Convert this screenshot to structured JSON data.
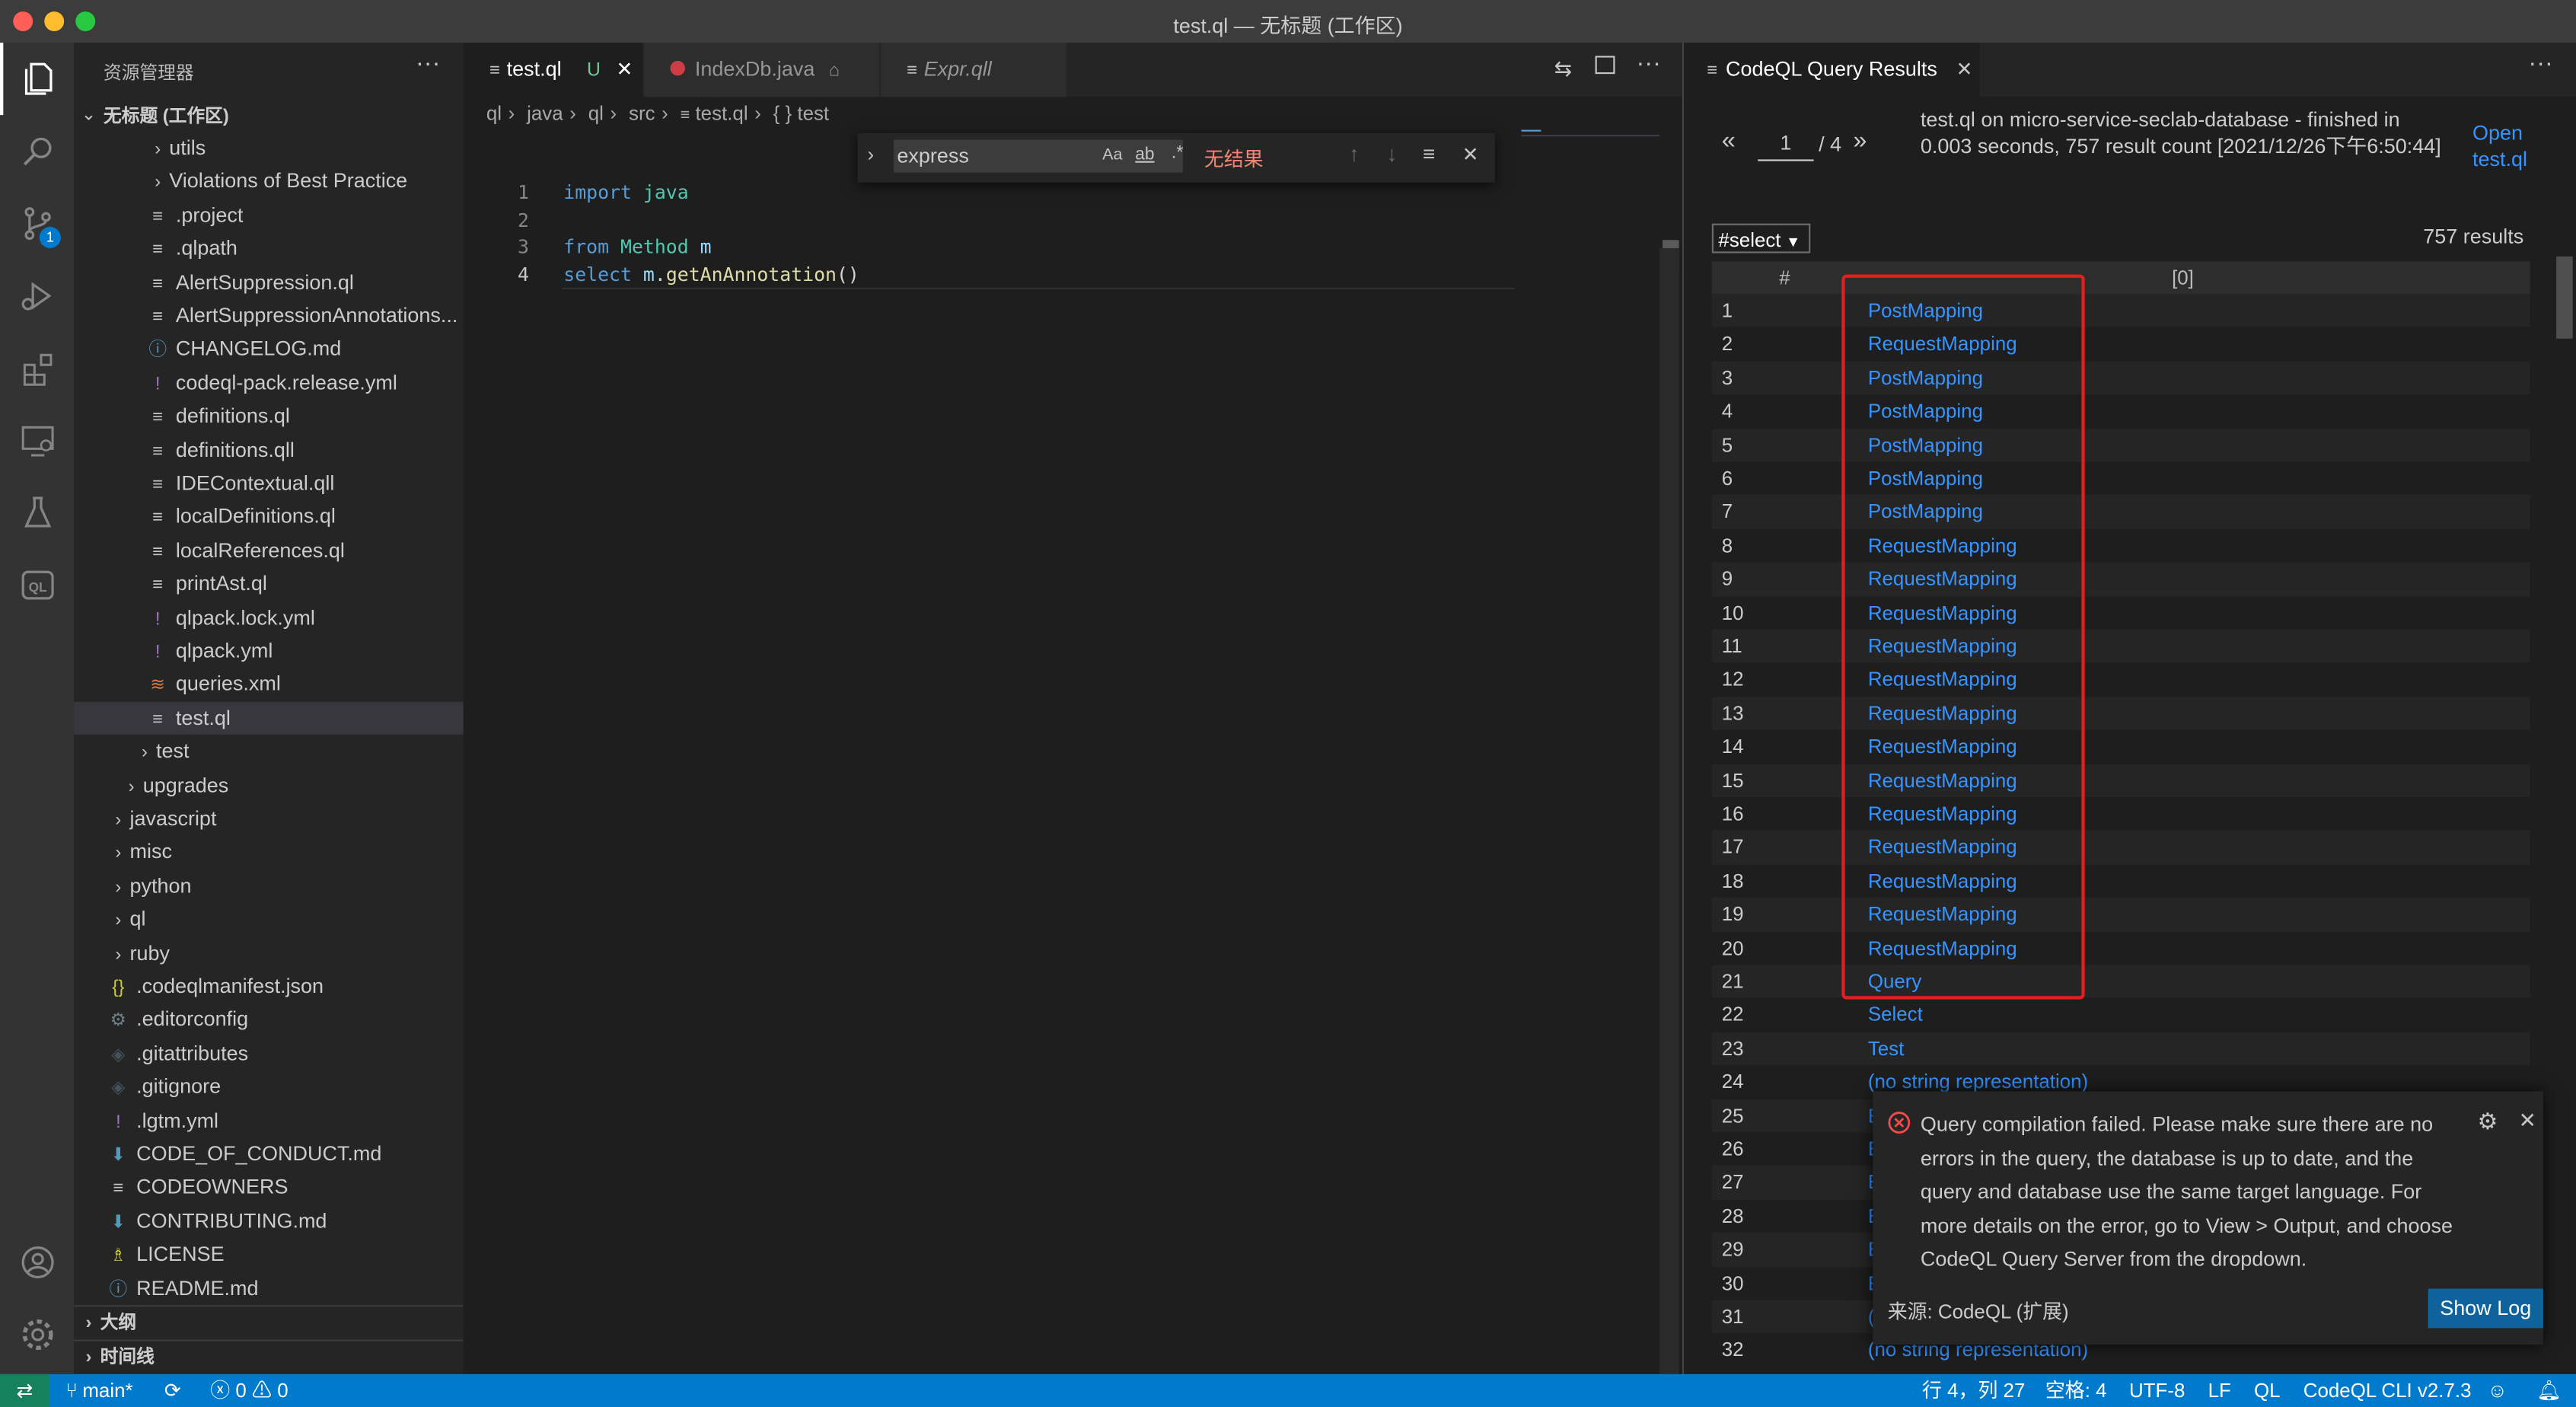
{
  "window": {
    "title": "test.ql — 无标题 (工作区)"
  },
  "activity_bar": {
    "source_control_badge": "1"
  },
  "explorer": {
    "header": "资源管理器",
    "workspace": "无标题 (工作区)",
    "items": [
      {
        "label": "utils",
        "kind": "folder",
        "status": ""
      },
      {
        "label": "Violations of Best Practice",
        "kind": "folder",
        "status": ""
      },
      {
        "label": ".project",
        "kind": "file",
        "status": ""
      },
      {
        "label": ".qlpath",
        "kind": "file",
        "status": ""
      },
      {
        "label": "AlertSuppression.ql",
        "kind": "file",
        "status": ""
      },
      {
        "label": "AlertSuppressionAnnotations...",
        "kind": "file",
        "status": ""
      },
      {
        "label": "CHANGELOG.md",
        "kind": "md",
        "status": ""
      },
      {
        "label": "codeql-pack.release.yml",
        "kind": "yml",
        "status": ""
      },
      {
        "label": "definitions.ql",
        "kind": "file",
        "status": ""
      },
      {
        "label": "definitions.qll",
        "kind": "file",
        "status": ""
      },
      {
        "label": "IDEContextual.qll",
        "kind": "file",
        "status": ""
      },
      {
        "label": "localDefinitions.ql",
        "kind": "file",
        "status": ""
      },
      {
        "label": "localReferences.ql",
        "kind": "file",
        "status": ""
      },
      {
        "label": "printAst.ql",
        "kind": "file",
        "status": ""
      },
      {
        "label": "qlpack.lock.yml",
        "kind": "yml",
        "status": ""
      },
      {
        "label": "qlpack.yml",
        "kind": "yml",
        "status": ""
      },
      {
        "label": "queries.xml",
        "kind": "xml",
        "status": ""
      },
      {
        "label": "test.ql",
        "kind": "file",
        "status": "U"
      },
      {
        "label": "test",
        "kind": "folder",
        "status": ""
      },
      {
        "label": "upgrades",
        "kind": "folder",
        "status": ""
      },
      {
        "label": "javascript",
        "kind": "folder",
        "status": ""
      },
      {
        "label": "misc",
        "kind": "folder",
        "status": ""
      },
      {
        "label": "python",
        "kind": "folder",
        "status": ""
      },
      {
        "label": "ql",
        "kind": "folder",
        "status": ""
      },
      {
        "label": "ruby",
        "kind": "folder",
        "status": ""
      },
      {
        "label": ".codeqlmanifest.json",
        "kind": "json",
        "status": ""
      },
      {
        "label": ".editorconfig",
        "kind": "gear",
        "status": ""
      },
      {
        "label": ".gitattributes",
        "kind": "git",
        "status": ""
      },
      {
        "label": ".gitignore",
        "kind": "git",
        "status": ""
      },
      {
        "label": ".lgtm.yml",
        "kind": "yml",
        "status": ""
      },
      {
        "label": "CODE_OF_CONDUCT.md",
        "kind": "dl",
        "status": ""
      },
      {
        "label": "CODEOWNERS",
        "kind": "file",
        "status": ""
      },
      {
        "label": "CONTRIBUTING.md",
        "kind": "dl",
        "status": ""
      },
      {
        "label": "LICENSE",
        "kind": "license",
        "status": ""
      },
      {
        "label": "README.md",
        "kind": "info",
        "status": ""
      }
    ],
    "outline": "大纲",
    "timeline": "时间线"
  },
  "editor": {
    "tabs": [
      {
        "label": "test.ql",
        "status": "U"
      },
      {
        "label": "IndexDb.java",
        "status": ""
      },
      {
        "label": "Expr.qll",
        "status": ""
      }
    ],
    "breadcrumb": [
      "ql",
      "java",
      "ql",
      "src",
      "test.ql",
      "{ } test"
    ],
    "find": {
      "value": "express",
      "opt_case": "Aa",
      "opt_word": "ab",
      "opt_regex": ".*",
      "result": "无结果"
    },
    "lines": [
      {
        "n": "1",
        "tokens": [
          {
            "t": "import",
            "c": "kw"
          },
          {
            "t": " ",
            "c": "tx"
          },
          {
            "t": "java",
            "c": "ty"
          }
        ]
      },
      {
        "n": "2",
        "tokens": []
      },
      {
        "n": "3",
        "tokens": [
          {
            "t": "from",
            "c": "kw"
          },
          {
            "t": " ",
            "c": "tx"
          },
          {
            "t": "Method",
            "c": "ty"
          },
          {
            "t": " ",
            "c": "tx"
          },
          {
            "t": "m",
            "c": "vr"
          }
        ]
      },
      {
        "n": "4",
        "tokens": [
          {
            "t": "select",
            "c": "kw"
          },
          {
            "t": " ",
            "c": "tx"
          },
          {
            "t": "m",
            "c": "vr"
          },
          {
            "t": ".",
            "c": "tx"
          },
          {
            "t": "getAnAnnotation",
            "c": "fn"
          },
          {
            "t": "()",
            "c": "tx"
          }
        ]
      }
    ]
  },
  "results": {
    "tab_label": "CodeQL Query Results",
    "page_current": "1",
    "page_total": "/ 4",
    "info": "test.ql on micro-service-seclab-database - finished in 0.003 seconds, 757 result count [2021/12/26下午6:50:44]",
    "open_link": "Open test.ql",
    "result_set": "#select",
    "count": "757 results",
    "columns": [
      "#",
      "[0]"
    ],
    "rows": [
      {
        "n": "1",
        "v": "PostMapping"
      },
      {
        "n": "2",
        "v": "RequestMapping"
      },
      {
        "n": "3",
        "v": "PostMapping"
      },
      {
        "n": "4",
        "v": "PostMapping"
      },
      {
        "n": "5",
        "v": "PostMapping"
      },
      {
        "n": "6",
        "v": "PostMapping"
      },
      {
        "n": "7",
        "v": "PostMapping"
      },
      {
        "n": "8",
        "v": "RequestMapping"
      },
      {
        "n": "9",
        "v": "RequestMapping"
      },
      {
        "n": "10",
        "v": "RequestMapping"
      },
      {
        "n": "11",
        "v": "RequestMapping"
      },
      {
        "n": "12",
        "v": "RequestMapping"
      },
      {
        "n": "13",
        "v": "RequestMapping"
      },
      {
        "n": "14",
        "v": "RequestMapping"
      },
      {
        "n": "15",
        "v": "RequestMapping"
      },
      {
        "n": "16",
        "v": "RequestMapping"
      },
      {
        "n": "17",
        "v": "RequestMapping"
      },
      {
        "n": "18",
        "v": "RequestMapping"
      },
      {
        "n": "19",
        "v": "RequestMapping"
      },
      {
        "n": "20",
        "v": "RequestMapping"
      },
      {
        "n": "21",
        "v": "Query"
      },
      {
        "n": "22",
        "v": "Select"
      },
      {
        "n": "23",
        "v": "Test"
      },
      {
        "n": "24",
        "v": "(no string representation)"
      },
      {
        "n": "25",
        "v": "E"
      },
      {
        "n": "26",
        "v": "E"
      },
      {
        "n": "27",
        "v": "E"
      },
      {
        "n": "28",
        "v": "E"
      },
      {
        "n": "29",
        "v": "E"
      },
      {
        "n": "30",
        "v": "E"
      },
      {
        "n": "31",
        "v": "("
      },
      {
        "n": "32",
        "v": "(no string representation)"
      }
    ]
  },
  "notification": {
    "message": "Query compilation failed. Please make sure there are no errors in the query, the database is up to date, and the query and database use the same target language. For more details on the error, go to View > Output, and choose CodeQL Query Server from the dropdown.",
    "source": "来源: CodeQL (扩展)",
    "button": "Show Log"
  },
  "statusbar": {
    "branch": "main*",
    "errors": "0",
    "warnings": "0",
    "position": "行 4，列 27",
    "spaces": "空格: 4",
    "encoding": "UTF-8",
    "eol": "LF",
    "language": "QL",
    "cli": "CodeQL CLI v2.7.3"
  },
  "colors": {
    "accent": "#007acc",
    "link": "#3794ff",
    "error": "#f14c4c",
    "highlight_box": "#e02020"
  }
}
